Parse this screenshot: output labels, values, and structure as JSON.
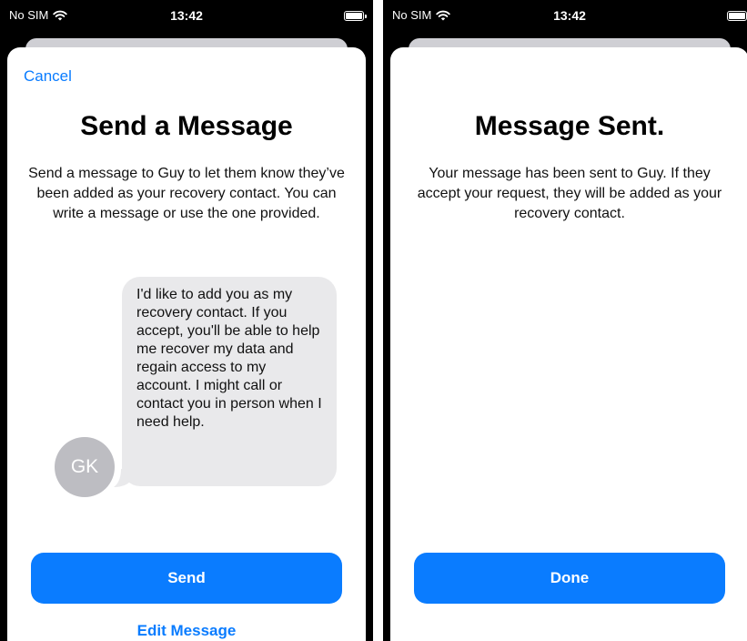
{
  "status_bar": {
    "carrier": "No SIM",
    "time": "13:42"
  },
  "send_screen": {
    "cancel_label": "Cancel",
    "title": "Send a Message",
    "description": "Send a message to Guy to let them know they’ve been added as your recovery contact. You can write a message or use the one provided.",
    "message_text": "I'd like to add you as my recovery contact. If you accept, you'll be able to help me recover my data and regain access to my account. I might call or contact you in person when I need help.",
    "avatar_initials": "GK",
    "send_label": "Send",
    "edit_label": "Edit Message"
  },
  "sent_screen": {
    "title": "Message Sent.",
    "description": "Your message has been sent to Guy. If they accept your request, they will be added as your recovery contact.",
    "done_label": "Done"
  },
  "icons": {
    "signal": "wifi-icon",
    "battery": "battery-icon"
  },
  "colors": {
    "accent": "#0a7cff",
    "bubble": "#e9e9eb",
    "avatar": "#bdbdc2"
  }
}
